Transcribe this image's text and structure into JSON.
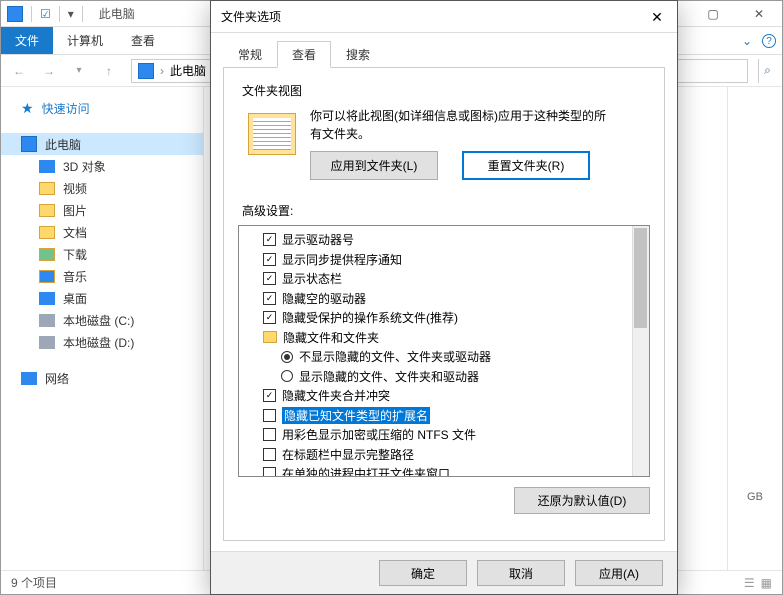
{
  "explorer": {
    "title": "此电脑",
    "ribbon": {
      "file": "文件",
      "computer": "计算机",
      "view": "查看"
    },
    "address": "此电脑",
    "sidebar": {
      "quick": "快速访问",
      "thispc": "此电脑",
      "items": [
        "3D 对象",
        "视频",
        "图片",
        "文档",
        "下载",
        "音乐",
        "桌面",
        "本地磁盘 (C:)",
        "本地磁盘 (D:)"
      ],
      "network": "网络"
    },
    "right_gb": "GB",
    "status": "9 个项目"
  },
  "dialog": {
    "title": "文件夹选项",
    "tabs": [
      "常规",
      "查看",
      "搜索"
    ],
    "folderview": {
      "section": "文件夹视图",
      "desc": "你可以将此视图(如详细信息或图标)应用于这种类型的所有文件夹。",
      "apply": "应用到文件夹(L)",
      "reset": "重置文件夹(R)"
    },
    "adv": {
      "title": "高级设置:",
      "items": [
        {
          "type": "cb",
          "checked": true,
          "indent": 0,
          "label": "显示驱动器号"
        },
        {
          "type": "cb",
          "checked": true,
          "indent": 0,
          "label": "显示同步提供程序通知"
        },
        {
          "type": "cb",
          "checked": true,
          "indent": 0,
          "label": "显示状态栏"
        },
        {
          "type": "cb",
          "checked": true,
          "indent": 0,
          "label": "隐藏空的驱动器"
        },
        {
          "type": "cb",
          "checked": true,
          "indent": 0,
          "label": "隐藏受保护的操作系统文件(推荐)"
        },
        {
          "type": "folder",
          "indent": 0,
          "label": "隐藏文件和文件夹"
        },
        {
          "type": "rb",
          "checked": true,
          "indent": 1,
          "label": "不显示隐藏的文件、文件夹或驱动器"
        },
        {
          "type": "rb",
          "checked": false,
          "indent": 1,
          "label": "显示隐藏的文件、文件夹和驱动器"
        },
        {
          "type": "cb",
          "checked": true,
          "indent": 0,
          "label": "隐藏文件夹合并冲突"
        },
        {
          "type": "cb",
          "checked": false,
          "indent": 0,
          "label": "隐藏已知文件类型的扩展名",
          "highlight": true
        },
        {
          "type": "cb",
          "checked": false,
          "indent": 0,
          "label": "用彩色显示加密或压缩的 NTFS 文件"
        },
        {
          "type": "cb",
          "checked": false,
          "indent": 0,
          "label": "在标题栏中显示完整路径"
        },
        {
          "type": "cb",
          "checked": false,
          "indent": 0,
          "label": "在单独的进程中打开文件夹窗口"
        }
      ],
      "restore": "还原为默认值(D)"
    },
    "buttons": {
      "ok": "确定",
      "cancel": "取消",
      "apply": "应用(A)"
    }
  }
}
